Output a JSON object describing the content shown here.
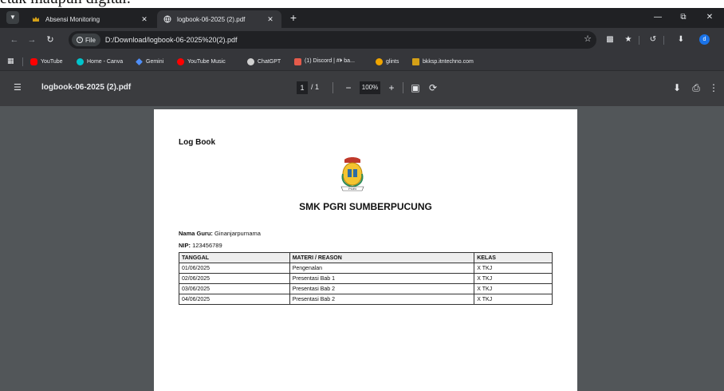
{
  "backdrop_text": "etak maupun digital.",
  "tabs": [
    {
      "title": "Absensi Monitoring",
      "favicon": "crown-icon",
      "active": false
    },
    {
      "title": "logbook-06-2025 (2).pdf",
      "favicon": "globe-icon",
      "active": true
    }
  ],
  "toolbar": {
    "chip_label": "File",
    "url": "D:/Download/logbook-06-2025%20(2).pdf",
    "profile_initial": "d"
  },
  "bookmarks": [
    {
      "label": "YouTube",
      "icon": "youtube-icon",
      "color": "#ff0000"
    },
    {
      "label": "Home - Canva",
      "icon": "canva-icon",
      "color": "#00c4cc"
    },
    {
      "label": "Gemini",
      "icon": "gemini-icon",
      "color": "#4f8ef7"
    },
    {
      "label": "YouTube Music",
      "icon": "youtube-music-icon",
      "color": "#ff0000"
    },
    {
      "label": "ChatGPT",
      "icon": "chatgpt-icon",
      "color": "#d0d0d0"
    },
    {
      "label": "(1) Discord | #⏵ ba...",
      "icon": "discord-icon",
      "color": "#e55b4b"
    },
    {
      "label": "glints",
      "icon": "glints-icon",
      "color": "#f0a500"
    },
    {
      "label": "bkksp.itntechno.com",
      "icon": "crown-icon",
      "color": "#d4a017"
    }
  ],
  "pdf_viewer": {
    "file_title": "logbook-06-2025 (2).pdf",
    "current_page": "1",
    "page_separator": "/ 1",
    "zoom": "100%"
  },
  "document": {
    "heading": "Log Book",
    "school_name": "SMK PGRI SUMBERPUCUNG",
    "logo_text": "PGRI",
    "teacher_label": "Nama Guru:",
    "teacher_name": "Ginanjarpurnama",
    "nip_label": "NIP:",
    "nip_value": "123456789",
    "table": {
      "headers": [
        "TANGGAL",
        "MATERI / REASON",
        "KELAS"
      ],
      "rows": [
        [
          "01/06/2025",
          "Pengenalan",
          "X TKJ"
        ],
        [
          "02/06/2025",
          "Presentasi Bab 1",
          "X TKJ"
        ],
        [
          "03/06/2025",
          "Presentasi Bab 2",
          "X TKJ"
        ],
        [
          "04/06/2025",
          "Presentasi Bab 2",
          "X TKJ"
        ]
      ]
    }
  }
}
